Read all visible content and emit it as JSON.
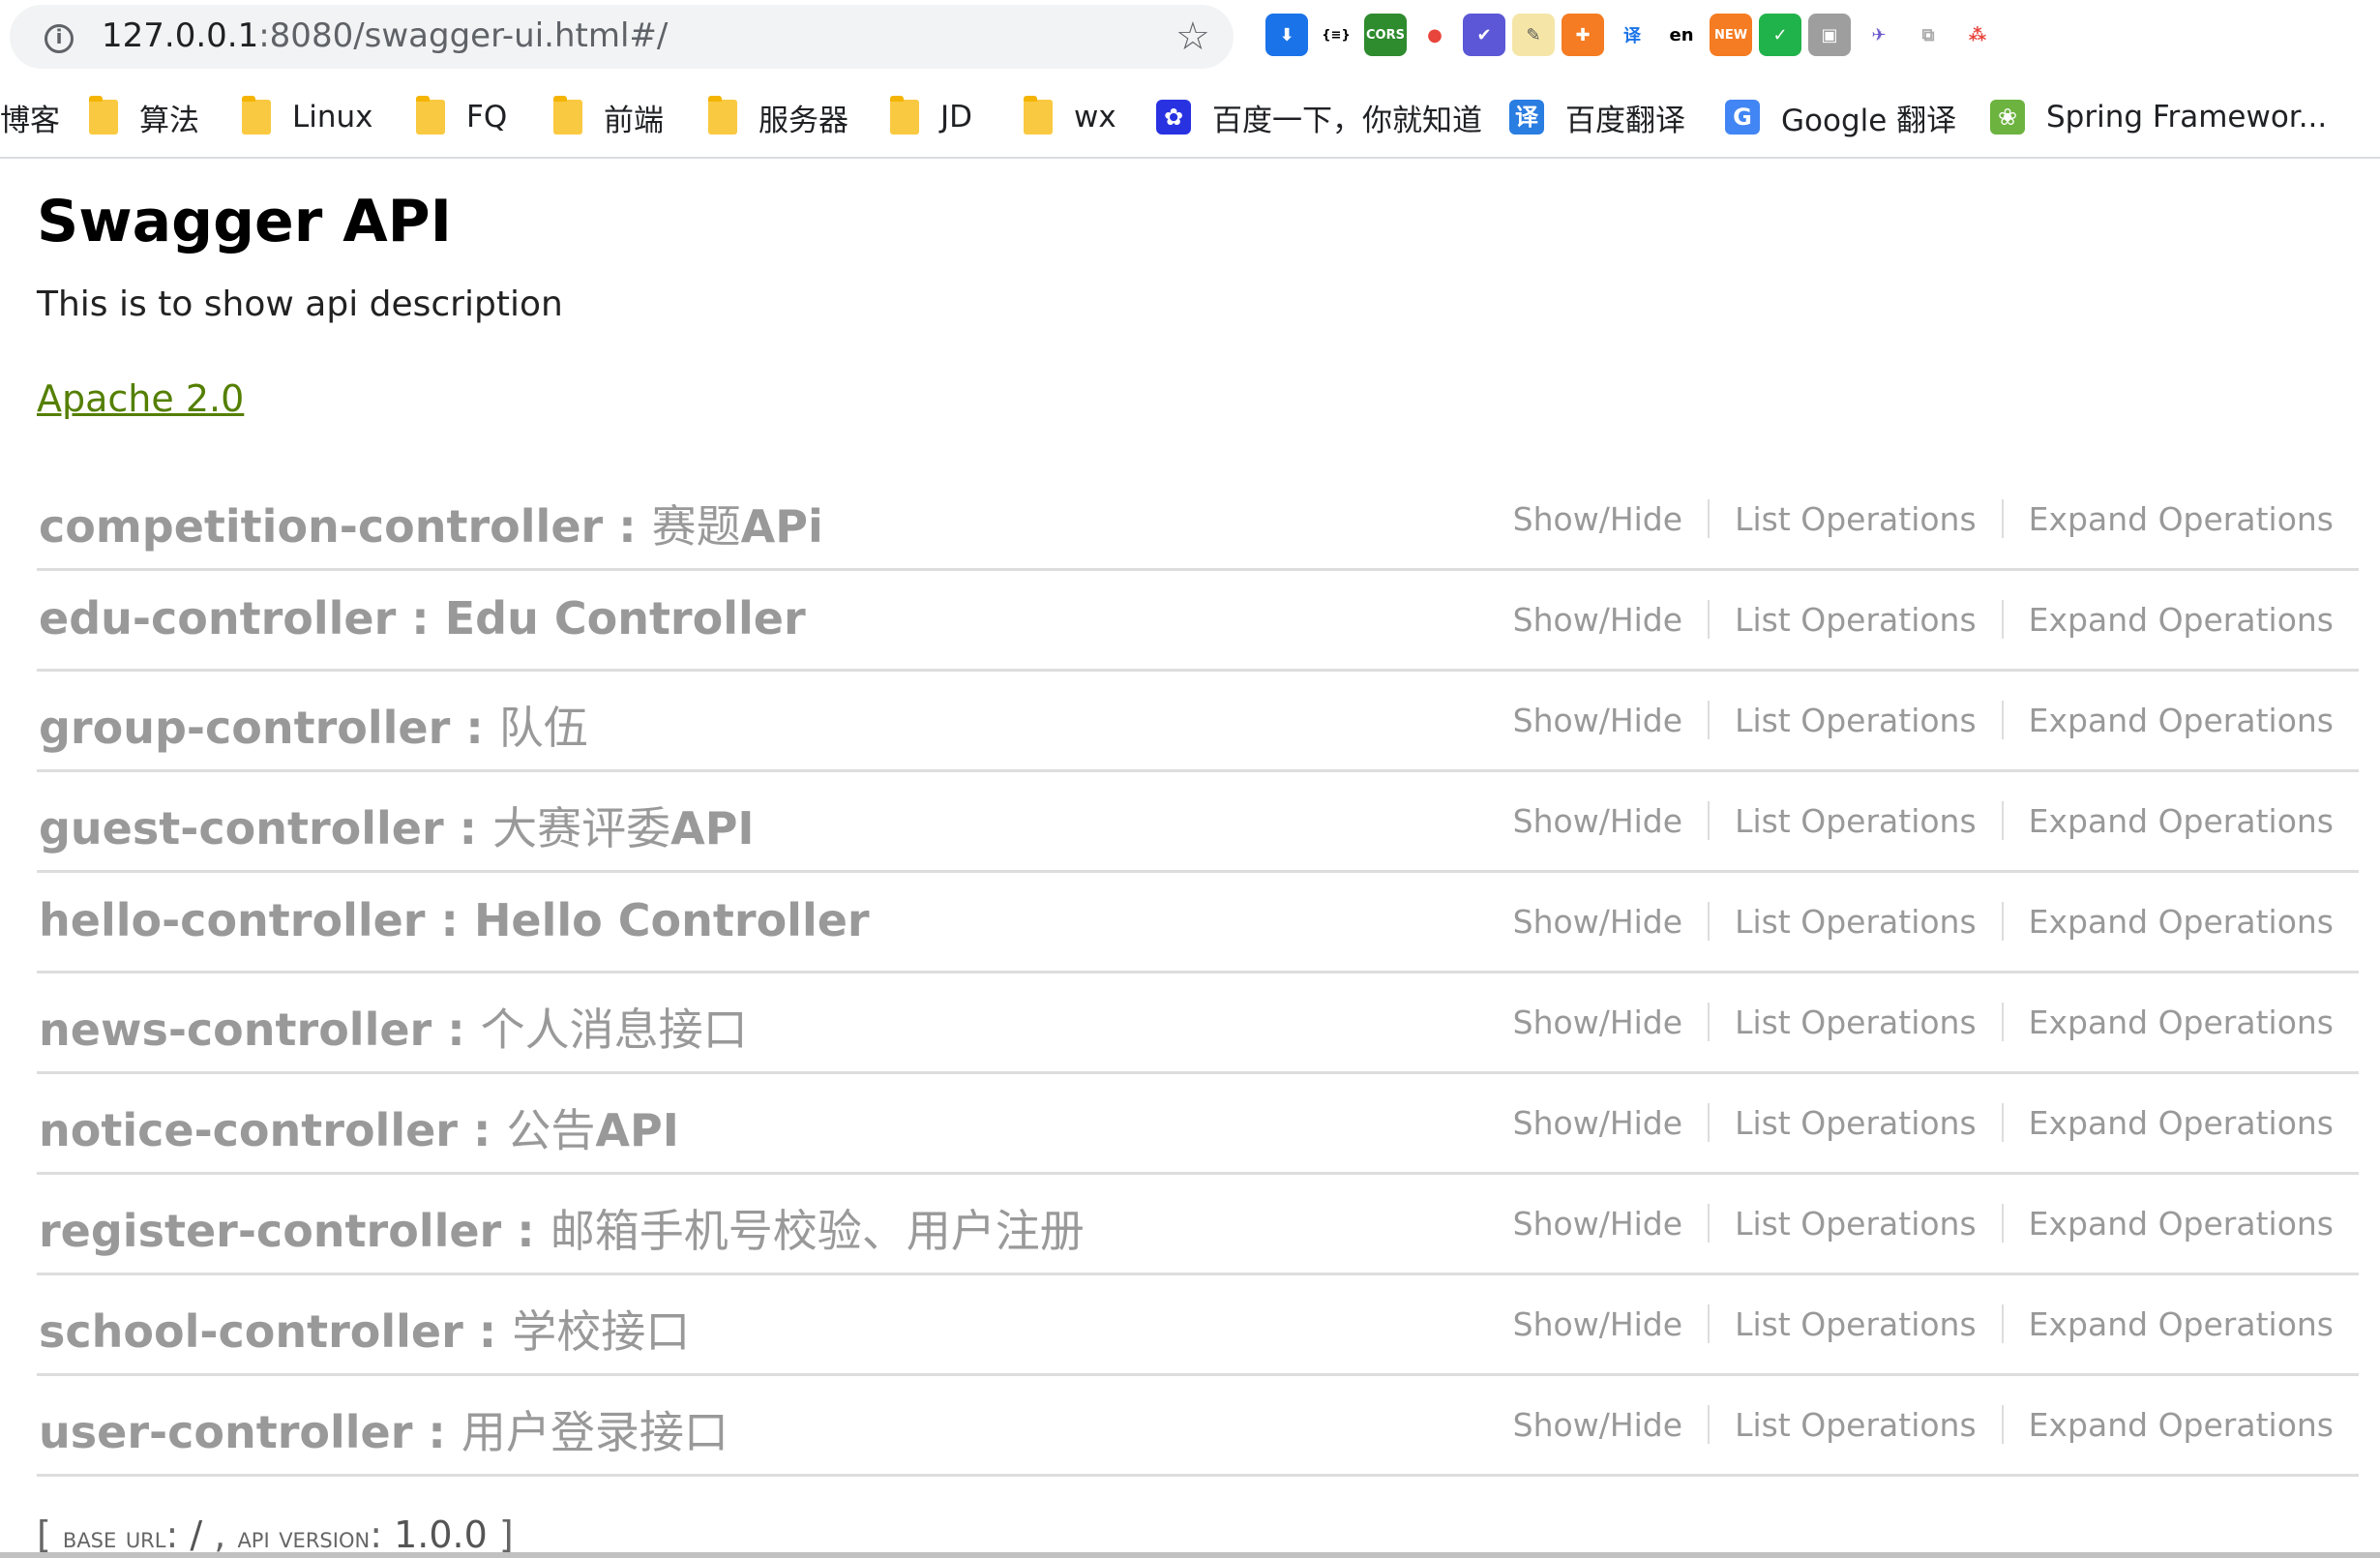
{
  "browser": {
    "url_host": "127.0.0.1",
    "url_rest": ":8080/swagger-ui.html#/",
    "extensions": [
      {
        "name": "pocket-icon",
        "glyph": "⬇",
        "bg": "#1a73e8"
      },
      {
        "name": "json-formatter-icon",
        "glyph": "{≡}",
        "bg": "#ffffff",
        "fg": "#000000"
      },
      {
        "name": "cors-icon",
        "glyph": "CORS",
        "bg": "#2e8b2e"
      },
      {
        "name": "maps-pin-icon",
        "glyph": "●",
        "bg": "#ffffff",
        "fg": "#e8453c"
      },
      {
        "name": "check-circle-icon",
        "glyph": "✔",
        "bg": "#5b57d6"
      },
      {
        "name": "notes-icon",
        "glyph": "✎",
        "bg": "#f5e6a8",
        "fg": "#555555"
      },
      {
        "name": "lifebuoy-icon",
        "glyph": "✚",
        "bg": "#f57c22"
      },
      {
        "name": "translate-icon",
        "glyph": "译",
        "bg": "#ffffff",
        "fg": "#1a73e8"
      },
      {
        "name": "en-translate-icon",
        "glyph": "en",
        "bg": "#ffffff",
        "fg": "#000000"
      },
      {
        "name": "new-badge-icon",
        "glyph": "NEW",
        "bg": "#f57c22"
      },
      {
        "name": "yandex-icon",
        "glyph": "✓",
        "bg": "#21b34b"
      },
      {
        "name": "screenshot-icon",
        "glyph": "▣",
        "bg": "#9e9e9e"
      },
      {
        "name": "bird-icon",
        "glyph": "✈",
        "bg": "#ffffff",
        "fg": "#6a5acd"
      },
      {
        "name": "puzzle-icon",
        "glyph": "⧉",
        "bg": "#ffffff",
        "fg": "#aaaaaa"
      },
      {
        "name": "network-icon",
        "glyph": "⁂",
        "bg": "#ffffff",
        "fg": "#e8453c"
      }
    ]
  },
  "bookmarks": [
    {
      "label": "博客",
      "type": "text"
    },
    {
      "label": "算法",
      "type": "folder"
    },
    {
      "label": "Linux",
      "type": "folder"
    },
    {
      "label": "FQ",
      "type": "folder"
    },
    {
      "label": "前端",
      "type": "folder"
    },
    {
      "label": "服务器",
      "type": "folder"
    },
    {
      "label": "JD",
      "type": "folder"
    },
    {
      "label": "wx",
      "type": "folder"
    },
    {
      "label": "百度一下，你就知道",
      "type": "site",
      "icon": "baidu-paw-icon"
    },
    {
      "label": "百度翻译",
      "type": "site",
      "icon": "baidu-translate-icon"
    },
    {
      "label": "Google 翻译",
      "type": "site",
      "icon": "google-translate-icon"
    },
    {
      "label": "Spring Framewor...",
      "type": "site",
      "icon": "spring-icon"
    }
  ],
  "swagger": {
    "title": "Swagger API",
    "description": "This is to show api description",
    "license": "Apache 2.0",
    "op_labels": {
      "show_hide": "Show/Hide",
      "list": "List Operations",
      "expand": "Expand Operations"
    },
    "resources": [
      {
        "name": "competition-controller",
        "desc": "赛题",
        "desc_latin": "APi"
      },
      {
        "name": "edu-controller",
        "desc": "",
        "desc_latin": "Edu Controller"
      },
      {
        "name": "group-controller",
        "desc": "队伍",
        "desc_latin": ""
      },
      {
        "name": "guest-controller",
        "desc": "大赛评委",
        "desc_latin": "API"
      },
      {
        "name": "hello-controller",
        "desc": "",
        "desc_latin": "Hello Controller"
      },
      {
        "name": "news-controller",
        "desc": "个人消息接口",
        "desc_latin": ""
      },
      {
        "name": "notice-controller",
        "desc": "公告",
        "desc_latin": "API"
      },
      {
        "name": "register-controller",
        "desc": "邮箱手机号校验、用户注册",
        "desc_latin": ""
      },
      {
        "name": "school-controller",
        "desc": "学校接口",
        "desc_latin": ""
      },
      {
        "name": "user-controller",
        "desc": "用户登录接口",
        "desc_latin": ""
      }
    ],
    "footer": {
      "base_url_label": "base url",
      "base_url": "/",
      "api_version_label": "api version",
      "api_version": "1.0.0"
    }
  }
}
